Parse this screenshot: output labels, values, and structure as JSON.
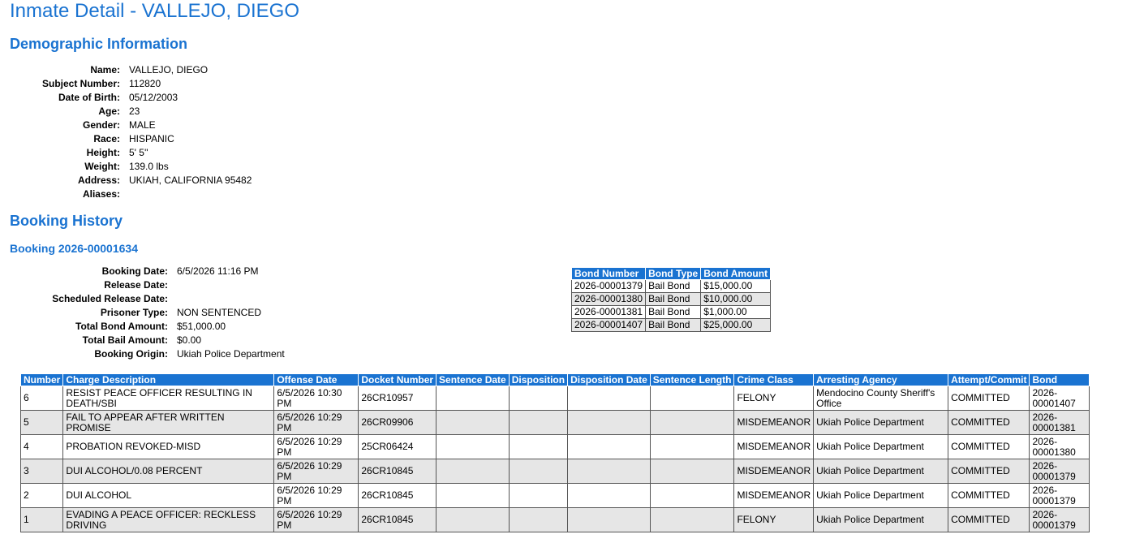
{
  "page": {
    "title": "Inmate Detail - VALLEJO, DIEGO"
  },
  "demographics": {
    "heading": "Demographic Information",
    "fields": [
      {
        "label": "Name:",
        "value": "VALLEJO, DIEGO"
      },
      {
        "label": "Subject Number:",
        "value": "112820"
      },
      {
        "label": "Date of Birth:",
        "value": "05/12/2003"
      },
      {
        "label": "Age:",
        "value": "23"
      },
      {
        "label": "Gender:",
        "value": "MALE"
      },
      {
        "label": "Race:",
        "value": "HISPANIC"
      },
      {
        "label": "Height:",
        "value": "5' 5''"
      },
      {
        "label": "Weight:",
        "value": "139.0 lbs"
      },
      {
        "label": "Address:",
        "value": "UKIAH, CALIFORNIA 95482"
      },
      {
        "label": "Aliases:",
        "value": ""
      }
    ]
  },
  "booking_history": {
    "heading": "Booking History",
    "booking_title": "Booking 2026-00001634",
    "fields": [
      {
        "label": "Booking Date:",
        "value": "6/5/2026 11:16 PM"
      },
      {
        "label": "Release Date:",
        "value": ""
      },
      {
        "label": "Scheduled Release Date:",
        "value": ""
      },
      {
        "label": "Prisoner Type:",
        "value": "NON SENTENCED"
      },
      {
        "label": "Total Bond Amount:",
        "value": "$51,000.00"
      },
      {
        "label": "Total Bail Amount:",
        "value": "$0.00"
      },
      {
        "label": "Booking Origin:",
        "value": "Ukiah Police Department"
      }
    ],
    "bonds": {
      "headers": [
        "Bond Number",
        "Bond Type",
        "Bond Amount"
      ],
      "rows": [
        [
          "2026-00001379",
          "Bail Bond",
          "$15,000.00"
        ],
        [
          "2026-00001380",
          "Bail Bond",
          "$10,000.00"
        ],
        [
          "2026-00001381",
          "Bail Bond",
          "$1,000.00"
        ],
        [
          "2026-00001407",
          "Bail Bond",
          "$25,000.00"
        ]
      ]
    },
    "charges": {
      "headers": [
        "Number",
        "Charge Description",
        "Offense Date",
        "Docket Number",
        "Sentence Date",
        "Disposition",
        "Disposition Date",
        "Sentence Length",
        "Crime Class",
        "Arresting Agency",
        "Attempt/Commit",
        "Bond"
      ],
      "rows": [
        [
          "6",
          "RESIST PEACE OFFICER RESULTING IN DEATH/SBI",
          "6/5/2026 10:30 PM",
          "26CR10957",
          "",
          "",
          "",
          "",
          "FELONY",
          "Mendocino County Sheriff's Office",
          "COMMITTED",
          "2026-00001407"
        ],
        [
          "5",
          "FAIL TO APPEAR AFTER WRITTEN PROMISE",
          "6/5/2026 10:29 PM",
          "26CR09906",
          "",
          "",
          "",
          "",
          "MISDEMEANOR",
          "Ukiah Police Department",
          "COMMITTED",
          "2026-00001381"
        ],
        [
          "4",
          "PROBATION REVOKED-MISD",
          "6/5/2026 10:29 PM",
          "25CR06424",
          "",
          "",
          "",
          "",
          "MISDEMEANOR",
          "Ukiah Police Department",
          "COMMITTED",
          "2026-00001380"
        ],
        [
          "3",
          "DUI ALCOHOL/0.08 PERCENT",
          "6/5/2026 10:29 PM",
          "26CR10845",
          "",
          "",
          "",
          "",
          "MISDEMEANOR",
          "Ukiah Police Department",
          "COMMITTED",
          "2026-00001379"
        ],
        [
          "2",
          "DUI ALCOHOL",
          "6/5/2026 10:29 PM",
          "26CR10845",
          "",
          "",
          "",
          "",
          "MISDEMEANOR",
          "Ukiah Police Department",
          "COMMITTED",
          "2026-00001379"
        ],
        [
          "1",
          "EVADING A PEACE OFFICER: RECKLESS DRIVING",
          "6/5/2026 10:29 PM",
          "26CR10845",
          "",
          "",
          "",
          "",
          "FELONY",
          "Ukiah Police Department",
          "COMMITTED",
          "2026-00001379"
        ]
      ]
    }
  }
}
